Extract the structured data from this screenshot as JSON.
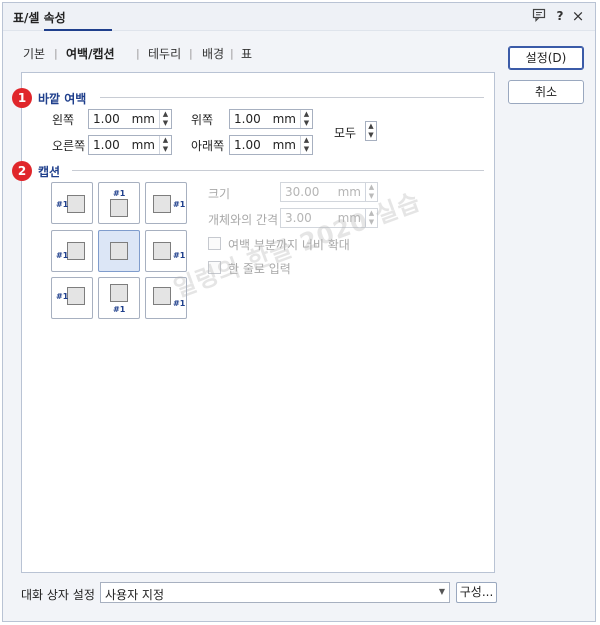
{
  "window": {
    "title": "표/셀 속성",
    "icons": [
      "comment-icon",
      "help-icon",
      "close-icon"
    ],
    "help_glyph": "?",
    "close_glyph": "×"
  },
  "tabs": [
    {
      "label": "기본",
      "active": false
    },
    {
      "label": "여백/캡션",
      "active": true
    },
    {
      "label": "테두리",
      "active": false
    },
    {
      "label": "배경",
      "active": false
    },
    {
      "label": "표",
      "active": false
    }
  ],
  "buttons": {
    "ok": "설정(D)",
    "cancel": "취소",
    "config": "구성..."
  },
  "outer_margin": {
    "badge": "1",
    "title": "바깥 여백",
    "left": {
      "label": "왼쪽",
      "value": "1.00",
      "unit": "mm"
    },
    "top": {
      "label": "위쪽",
      "value": "1.00",
      "unit": "mm"
    },
    "right": {
      "label": "오른쪽",
      "value": "1.00",
      "unit": "mm"
    },
    "bottom": {
      "label": "아래쪽",
      "value": "1.00",
      "unit": "mm"
    },
    "all": {
      "label": "모두"
    }
  },
  "caption": {
    "badge": "2",
    "title": "캡션",
    "tag": "#1",
    "size": {
      "label": "크기",
      "value": "30.00",
      "unit": "mm"
    },
    "gap": {
      "label": "개체와의 간격",
      "value": "3.00",
      "unit": "mm"
    },
    "expand_width": {
      "label": "여백 부분까지 너비 확대",
      "checked": false
    },
    "single_line": {
      "label": "한 줄로 입력",
      "checked": false
    }
  },
  "footer": {
    "label": "대화 상자 설정",
    "preset": "사용자 지정"
  },
  "watermark": "일렁의 한글 2020 실습",
  "colors": {
    "accent": "#1f3f8c",
    "badge": "#e0262b",
    "selected": "#dce6f6"
  }
}
